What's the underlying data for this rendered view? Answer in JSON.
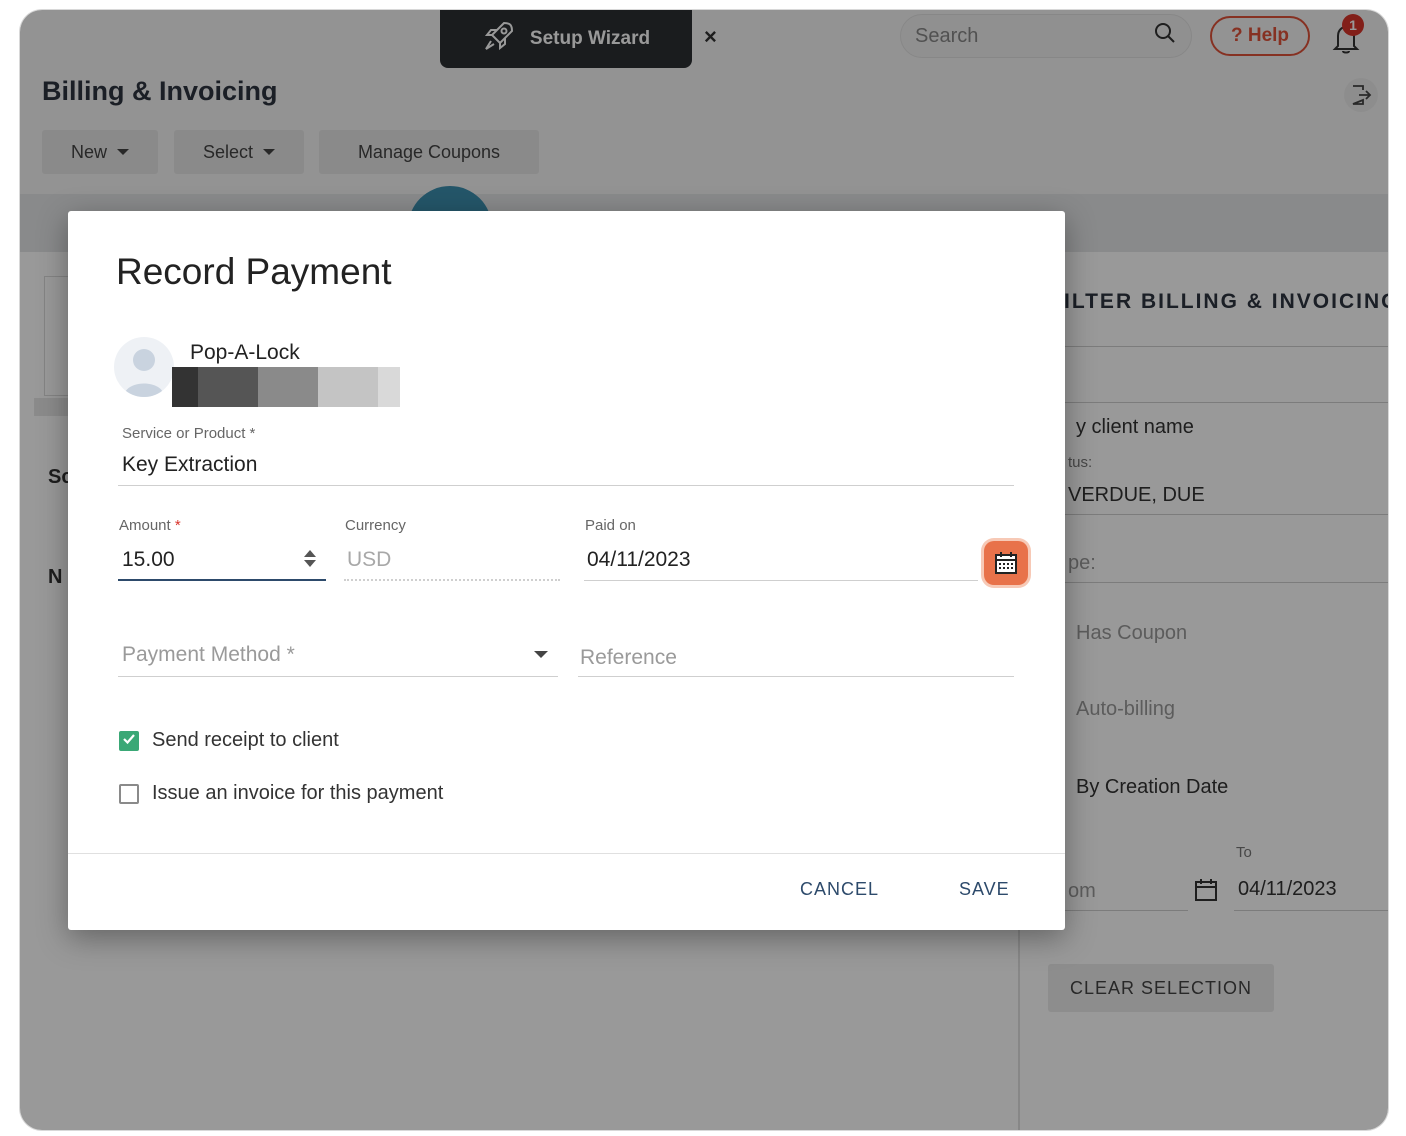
{
  "topbar": {
    "wizard_label": "Setup Wizard",
    "close_label": "×",
    "search_placeholder": "Search",
    "help_label": "? Help",
    "notification_count": "1"
  },
  "header": {
    "title": "Billing & Invoicing",
    "buttons": {
      "new": "New",
      "select": "Select",
      "manage_coupons": "Manage Coupons"
    }
  },
  "left_panel": {
    "text_1": "Sc",
    "text_2": "N"
  },
  "filter_panel": {
    "title": "ILTER BILLING & INVOICING",
    "search_placeholder": "y client name",
    "status_label": "tus:",
    "status_value": "VERDUE, DUE",
    "type_label": "pe:",
    "option_coupon": "Has Coupon",
    "option_autobilling": "Auto-billing",
    "option_creation_date": "By Creation Date",
    "to_label": "To",
    "from_placeholder": "om",
    "to_value": "04/11/2023",
    "clear_label": "CLEAR SELECTION"
  },
  "modal": {
    "title": "Record Payment",
    "client_name": "Pop-A-Lock",
    "service_label": "Service or Product *",
    "service_value": "Key Extraction",
    "amount_label": "Amount",
    "amount_required": "*",
    "amount_value": "15.00",
    "currency_label": "Currency",
    "currency_value": "USD",
    "paid_on_label": "Paid on",
    "paid_on_value": "04/11/2023",
    "payment_method_placeholder": "Payment Method *",
    "reference_placeholder": "Reference",
    "send_receipt_label": "Send receipt to client",
    "send_receipt_checked": true,
    "issue_invoice_label": "Issue an invoice for this payment",
    "issue_invoice_checked": false,
    "cancel_label": "CANCEL",
    "save_label": "SAVE"
  },
  "colors": {
    "accent_orange": "#e8724a",
    "help_red": "#e0533a",
    "check_green": "#3aa876",
    "action_blue": "#2d4a6b"
  },
  "icons": [
    "rocket-icon",
    "close-icon",
    "search-icon",
    "bell-icon",
    "logout-icon",
    "user-avatar-icon",
    "calendar-icon",
    "chevron-down-icon",
    "checkmark-icon"
  ]
}
